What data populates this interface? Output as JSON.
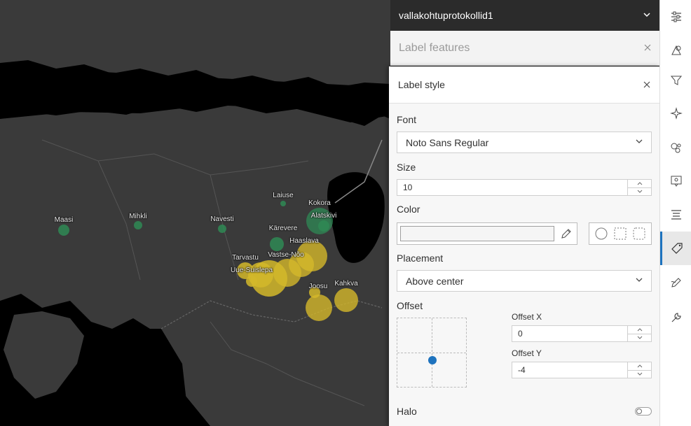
{
  "layer_header": {
    "title": "vallakohtuprotokollid1"
  },
  "label_features": {
    "title": "Label features"
  },
  "label_style": {
    "title": "Label style",
    "font": {
      "label": "Font",
      "value": "Noto Sans Regular"
    },
    "size": {
      "label": "Size",
      "value": "10"
    },
    "color": {
      "label": "Color"
    },
    "placement": {
      "label": "Placement",
      "value": "Above center"
    },
    "offset": {
      "label": "Offset",
      "x_label": "Offset X",
      "x_value": "0",
      "y_label": "Offset Y",
      "y_value": "-4"
    },
    "halo": {
      "label": "Halo",
      "enabled": false
    }
  },
  "map_labels": [
    "Maasi",
    "Mihkli",
    "Navesti",
    "Laiuse",
    "Kokora",
    "Alatskivi",
    "Kärevere",
    "Haaslava",
    "Tarvastu",
    "Vastse-Nõo",
    "Uue-Suislepa",
    "Joosu",
    "Kahkva"
  ],
  "colors": {
    "accent": "#1e73be",
    "header_bg": "#2b2b2b",
    "map_land": "#3a3a3a",
    "map_water": "#000000",
    "bubble_yellow": "#d4b82a",
    "bubble_green": "#2f8a55"
  },
  "toolbar_icons": [
    "properties-icon",
    "styles-icon",
    "filter-icon",
    "effects-icon",
    "clustering-icon",
    "popups-icon",
    "fields-icon",
    "labels-icon",
    "sketch-icon",
    "configure-icon"
  ]
}
